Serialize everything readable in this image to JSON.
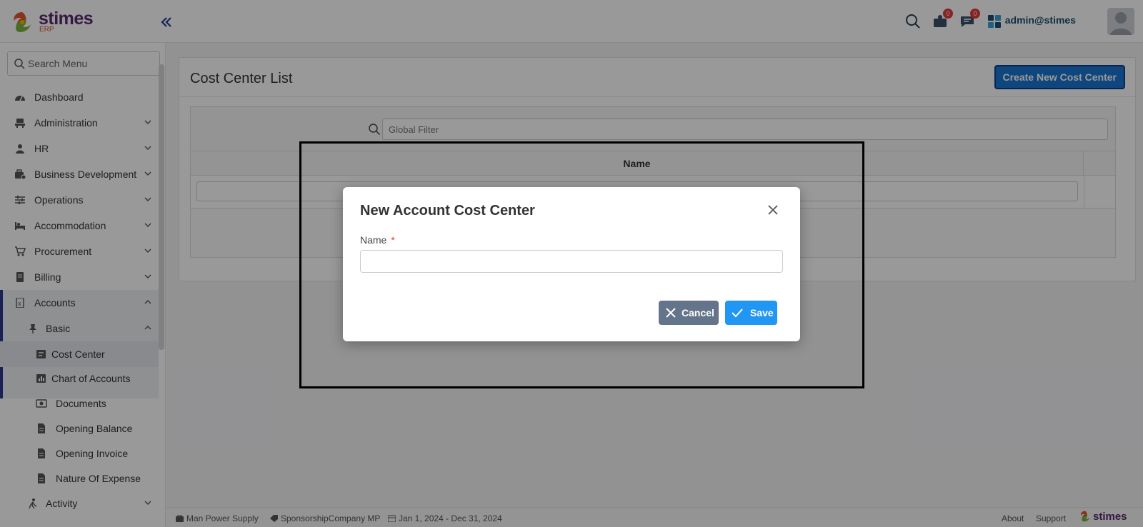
{
  "app": {
    "brand": "stimes",
    "brand_sub": "ERP",
    "user": "admin@stimes"
  },
  "header": {
    "notifications_count": "0",
    "messages_count": "0"
  },
  "sidebar": {
    "search_placeholder": "Search Menu",
    "items": [
      {
        "label": "Dashboard",
        "icon": "dashboard-icon"
      },
      {
        "label": "Administration",
        "icon": "admin-icon"
      },
      {
        "label": "HR",
        "icon": "hr-icon"
      },
      {
        "label": "Business Development",
        "icon": "business-icon"
      },
      {
        "label": "Operations",
        "icon": "operations-icon"
      },
      {
        "label": "Accommodation",
        "icon": "bed-icon"
      },
      {
        "label": "Procurement",
        "icon": "cart-icon"
      },
      {
        "label": "Billing",
        "icon": "billing-icon"
      },
      {
        "label": "Accounts",
        "icon": "accounts-icon"
      },
      {
        "label": "Basic",
        "icon": "pin-icon"
      },
      {
        "label": "Cost Center",
        "icon": "cost-center-icon"
      },
      {
        "label": "Chart of Accounts",
        "icon": "chart-icon"
      },
      {
        "label": "Documents",
        "icon": "money-icon"
      },
      {
        "label": "Opening Balance",
        "icon": "file-icon"
      },
      {
        "label": "Opening Invoice",
        "icon": "file-icon"
      },
      {
        "label": "Nature Of Expense",
        "icon": "file-icon"
      },
      {
        "label": "Activity",
        "icon": "activity-icon"
      }
    ]
  },
  "main": {
    "title": "Cost Center List",
    "create_button": "Create New Cost Center",
    "global_filter_placeholder": "Global Filter",
    "column_name": "Name"
  },
  "dialog": {
    "title": "New Account Cost Center",
    "name_label": "Name",
    "required_mark": "*",
    "cancel_label": "Cancel",
    "save_label": "Save"
  },
  "footer": {
    "company": "Man Power Supply",
    "sponsorship": "SponsorshipCompany MP",
    "date_range": "Jan 1, 2024 - Dec 31, 2024",
    "about": "About",
    "support": "Support"
  }
}
